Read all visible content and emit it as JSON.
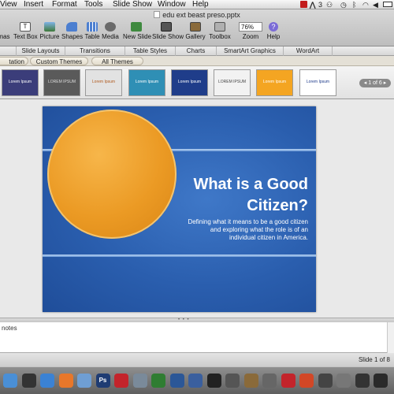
{
  "menubar": {
    "items": [
      "View",
      "Insert",
      "Format",
      "Tools",
      "Slide Show",
      "Window",
      "Help"
    ],
    "status_items": [
      "3"
    ]
  },
  "window": {
    "title": "edu ext beast preso.pptx"
  },
  "toolbar": {
    "buttons": [
      {
        "label": "mas",
        "icon": "gallery-icon"
      },
      {
        "label": "Text Box",
        "icon": "text-box-icon"
      },
      {
        "label": "Picture",
        "icon": "picture-icon"
      },
      {
        "label": "Shapes",
        "icon": "shapes-icon"
      },
      {
        "label": "Table",
        "icon": "table-icon"
      },
      {
        "label": "Media",
        "icon": "media-icon"
      },
      {
        "label": "New Slide",
        "icon": "new-slide-icon"
      },
      {
        "label": "Slide Show",
        "icon": "slide-show-icon"
      },
      {
        "label": "Gallery",
        "icon": "gallery-icon"
      },
      {
        "label": "Toolbox",
        "icon": "toolbox-icon"
      },
      {
        "label": "Zoom",
        "icon": "zoom-icon"
      },
      {
        "label": "Help",
        "icon": "help-icon"
      }
    ],
    "zoom_value": "76%"
  },
  "ribbon": {
    "tabs": [
      "Slide Layouts",
      "Transitions",
      "Table Styles",
      "Charts",
      "SmartArt Graphics",
      "WordArt"
    ]
  },
  "themes": {
    "subtabs": [
      "tation",
      "Custom Themes",
      "All Themes"
    ],
    "thumbnails": [
      {
        "text": "Lorem Ipsum",
        "bg": "#3b3d7a",
        "fg": "#ffffff"
      },
      {
        "text": "LOREM IPSUM",
        "bg": "#5a5a5a",
        "fg": "#dddddd"
      },
      {
        "text": "Lorem Ipsum",
        "bg": "#e2e2e2",
        "fg": "#b05a1e"
      },
      {
        "text": "Lorem Ipsum",
        "bg": "#2f8fb5",
        "fg": "#ffffff"
      },
      {
        "text": "Lorem Ipsum",
        "bg": "#1f3d8a",
        "fg": "#ffffff"
      },
      {
        "text": "LOREM IPSUM",
        "bg": "#f2f2f2",
        "fg": "#444444"
      },
      {
        "text": "Lorem Ipsum",
        "bg": "#f4a522",
        "fg": "#ffffff"
      },
      {
        "text": "Lorem Ipsum",
        "bg": "#ffffff",
        "fg": "#1d3a8a"
      }
    ],
    "pager": "1 of 6"
  },
  "slide": {
    "title_line1": "What is a Good",
    "title_line2": "Citizen?",
    "subtitle_line1": "Defining what it means to be a good citizen",
    "subtitle_line2": "and exploring what the role is of an",
    "subtitle_line3": "individual citizen in America."
  },
  "notes": {
    "placeholder": "notes"
  },
  "statusbar": {
    "slide_counter": "Slide 1 of 8"
  },
  "dock": {
    "icons": [
      {
        "name": "finder-icon",
        "color": "#4a8fd6",
        "glyph": ""
      },
      {
        "name": "dashboard-icon",
        "color": "#333333",
        "glyph": ""
      },
      {
        "name": "safari-icon",
        "color": "#3b82d4",
        "glyph": ""
      },
      {
        "name": "firefox-icon",
        "color": "#e8772a",
        "glyph": ""
      },
      {
        "name": "itunes-icon",
        "color": "#6f9ed3",
        "glyph": ""
      },
      {
        "name": "photoshop-icon",
        "color": "#1f3c73",
        "glyph": "Ps"
      },
      {
        "name": "acrobat-icon",
        "color": "#c3242b",
        "glyph": ""
      },
      {
        "name": "preview-icon",
        "color": "#7a8a9a",
        "glyph": ""
      },
      {
        "name": "excel-icon",
        "color": "#2f7d32",
        "glyph": ""
      },
      {
        "name": "word-icon",
        "color": "#2b5797",
        "glyph": ""
      },
      {
        "name": "keynote-icon",
        "color": "#3a5f9e",
        "glyph": ""
      },
      {
        "name": "terminal-icon",
        "color": "#222222",
        "glyph": ""
      },
      {
        "name": "app-icon",
        "color": "#555555",
        "glyph": ""
      },
      {
        "name": "app-icon",
        "color": "#8a6a3a",
        "glyph": ""
      },
      {
        "name": "app-icon",
        "color": "#666666",
        "glyph": ""
      },
      {
        "name": "acrobat-icon",
        "color": "#c3242b",
        "glyph": ""
      },
      {
        "name": "powerpoint-icon",
        "color": "#d24726",
        "glyph": ""
      },
      {
        "name": "app-icon",
        "color": "#444444",
        "glyph": ""
      },
      {
        "name": "app-icon",
        "color": "#777777",
        "glyph": ""
      },
      {
        "name": "app-icon",
        "color": "#333333",
        "glyph": ""
      },
      {
        "name": "app-icon",
        "color": "#2a2a2a",
        "glyph": ""
      }
    ]
  }
}
